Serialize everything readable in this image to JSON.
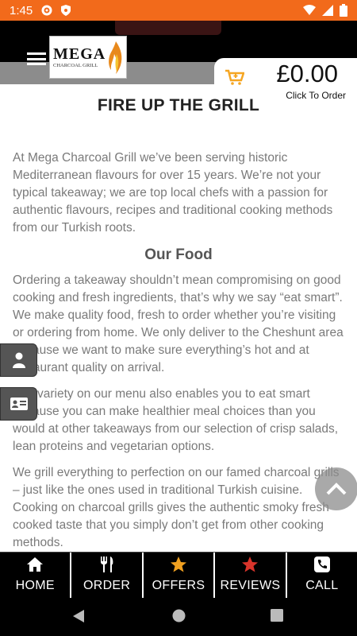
{
  "status_bar": {
    "time": "1:45"
  },
  "header": {
    "logo_main": "MEGA",
    "logo_sub": "CHARCOAL GRILL",
    "cart_amount": "£0.00",
    "cart_caption": "Click To Order"
  },
  "content": {
    "title": "FIRE UP THE GRILL",
    "intro": "At Mega Charcoal Grill we’ve been serving historic Mediterranean flavours for over 15 years. We’re not your typical takeaway; we are top local chefs with a passion for authentic flavours, recipes and traditional cooking methods from our Turkish roots.",
    "section_title": "Our Food",
    "para2": "Ordering a takeaway shouldn’t mean compromising on good cooking and fresh ingredients, that’s why we say “eat smart”. We make quality food, fresh to order whether you’re visiting or ordering from home. We only deliver to the Cheshunt area because we want to make sure everything’s hot and at restaurant quality on arrival.",
    "para3": "The variety on our menu also enables you to eat smart because you can make healthier meal choices than you would at other takeaways from our selection of crisp salads, lean proteins and vegetarian options.",
    "para4": "We grill everything to perfection on our famed charcoal grills – just like the ones used in traditional Turkish cuisine. Cooking on charcoal grills gives the authentic smoky fresh cooked taste that you simply don’t get from other cooking methods."
  },
  "bottom_nav": [
    {
      "label": "HOME",
      "icon": "home-icon",
      "color": "#ffffff"
    },
    {
      "label": "ORDER",
      "icon": "fork-knife-icon",
      "color": "#ffffff"
    },
    {
      "label": "OFFERS",
      "icon": "star-icon",
      "color": "#f0a020"
    },
    {
      "label": "REVIEWS",
      "icon": "star-icon",
      "color": "#d9342b"
    },
    {
      "label": "CALL",
      "icon": "phone-icon",
      "color": "#ffffff"
    }
  ],
  "colors": {
    "status_bar": "#f26a1b",
    "cart_icon": "#f5a623",
    "offers_star": "#f0a020",
    "reviews_star": "#d9342b"
  }
}
